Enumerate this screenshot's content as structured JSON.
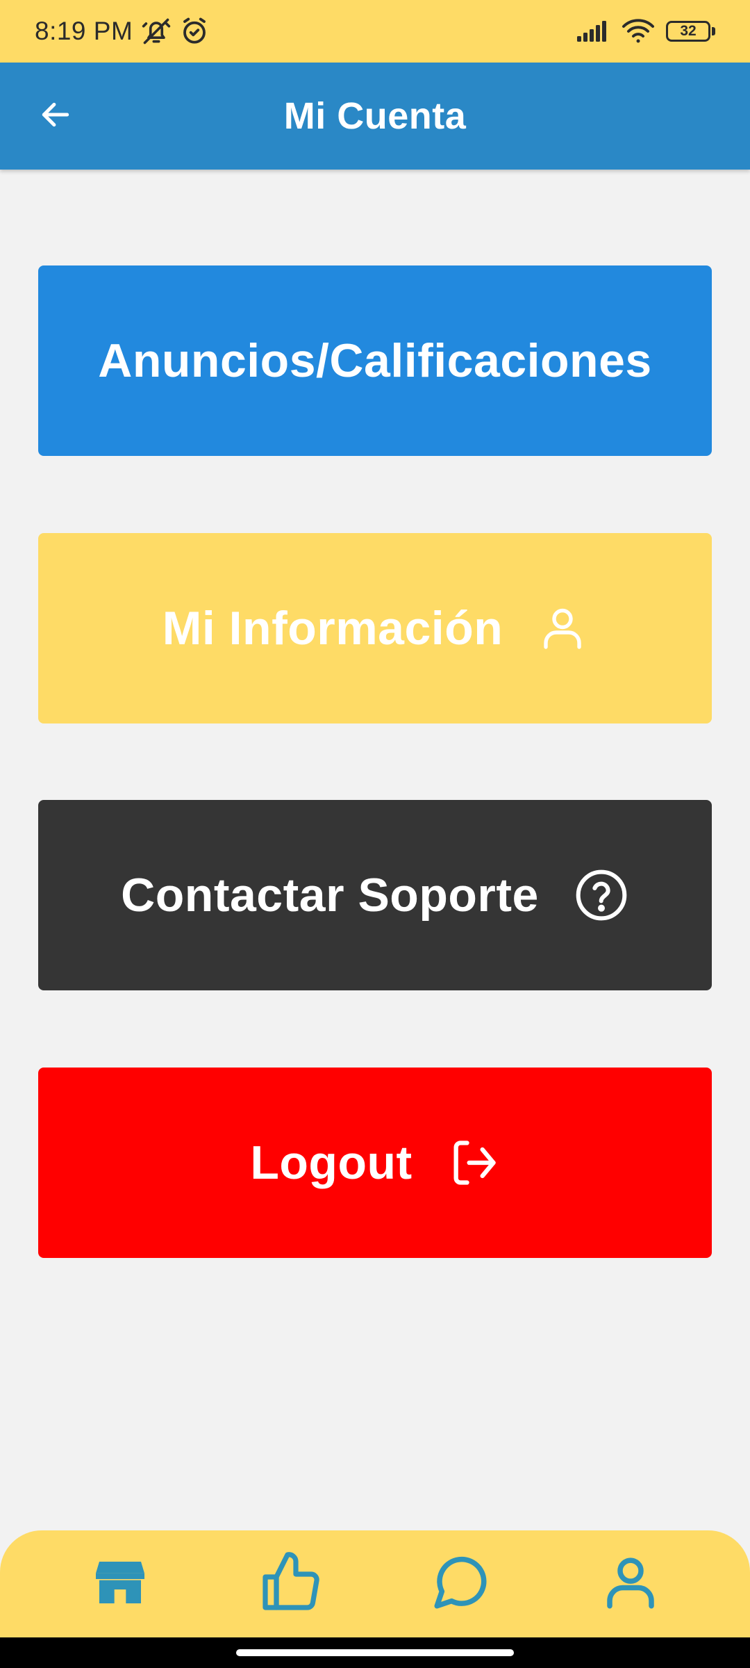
{
  "status_bar": {
    "time": "8:19 PM",
    "battery_level": "32",
    "icons": [
      "muted-bell-icon",
      "alarm-icon",
      "signal-icon",
      "wifi-icon",
      "battery-icon"
    ]
  },
  "app_bar": {
    "title": "Mi Cuenta",
    "back_icon": "arrow-left-icon"
  },
  "menu": {
    "ads_label": "Anuncios/Calificaciones",
    "info_label": "Mi Información",
    "info_icon": "user-icon",
    "support_label": "Contactar Soporte",
    "support_icon": "question-circle-icon",
    "logout_label": "Logout",
    "logout_icon": "logout-icon"
  },
  "bottom_nav": {
    "items": [
      "store-icon",
      "thumbs-up-icon",
      "chat-icon",
      "user-icon"
    ],
    "active_index": 0
  },
  "colors": {
    "status_bar": "#FEDB66",
    "app_bar": "#2A88C6",
    "background": "#F2F2F2",
    "ads_button": "#2289DE",
    "info_button": "#FEDB66",
    "support_button": "#353535",
    "logout_button": "#FF0000",
    "bottom_nav": "#FEDB66",
    "nav_icon": "#2E93B8"
  }
}
